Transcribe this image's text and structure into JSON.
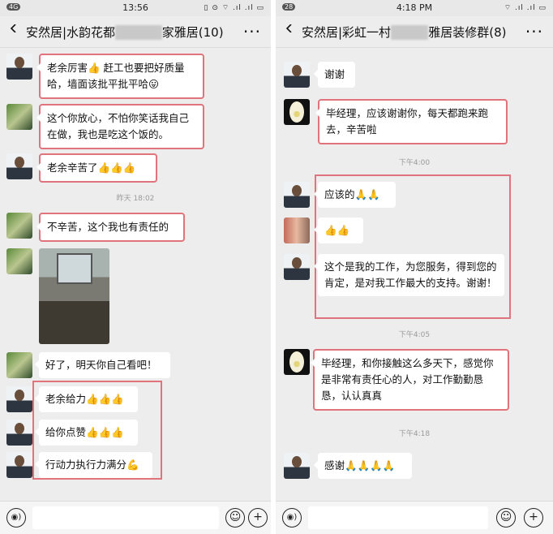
{
  "left": {
    "status": {
      "time": "13:56",
      "left_icons": "4G",
      "right_icons": "▯ ⊙ ⌔ .ıl .ıl ▭"
    },
    "title_prefix": "安然居|水韵花都",
    "title_blurred": "▇▇▇▇▇",
    "title_suffix": "家雅居(10)",
    "more": "···",
    "messages": [
      {
        "text": "老余厉害👍 赶工也要把好质量哈，墙面该批平批平哈😛"
      },
      {
        "text": "这个你放心，不怕你笑话我自己在做，我也是吃这个饭的。"
      },
      {
        "text": "老余辛苦了👍👍👍"
      },
      {
        "text": "不辛苦，这个我也有责任的"
      },
      {
        "text": "好了，明天你自己看吧！"
      },
      {
        "text": "老余给力👍👍👍"
      },
      {
        "text": "给你点赞👍👍👍"
      },
      {
        "text": "行动力执行力满分💪"
      }
    ],
    "timestamp": "昨天 18:02"
  },
  "right": {
    "status": {
      "time": "4:18 PM",
      "left_icons": "28",
      "right_icons": "⌔ .ıl .ıl ▭"
    },
    "title_prefix": "安然居|彩虹一村",
    "title_blurred": "▇▇▇▇",
    "title_suffix": "雅居装修群(8)",
    "more": "···",
    "messages": [
      {
        "text": "谢谢"
      },
      {
        "text": "毕经理，应该谢谢你，每天都跑来跑去，辛苦啦"
      },
      {
        "text": "应该的🙏🙏"
      },
      {
        "text": "👍👍"
      },
      {
        "text": "这个是我的工作，为您服务，得到您的肯定，是对我工作最大的支持。谢谢！"
      },
      {
        "text": "毕经理，和你接触这么多天下，感觉你是非常有责任心的人，对工作勤勤恳恳，认认真真"
      },
      {
        "text": "感谢🙏🙏🙏🙏"
      }
    ],
    "timestamps": [
      "下午4:00",
      "下午4:05",
      "下午4:18"
    ]
  },
  "icons": {
    "voice": "voice-icon",
    "emoji": "emoji-icon",
    "plus": "plus-icon",
    "back": "back-icon",
    "more": "more-icon"
  },
  "colors": {
    "highlight": "#e0737b",
    "background": "#ededed",
    "bubble": "#ffffff"
  }
}
